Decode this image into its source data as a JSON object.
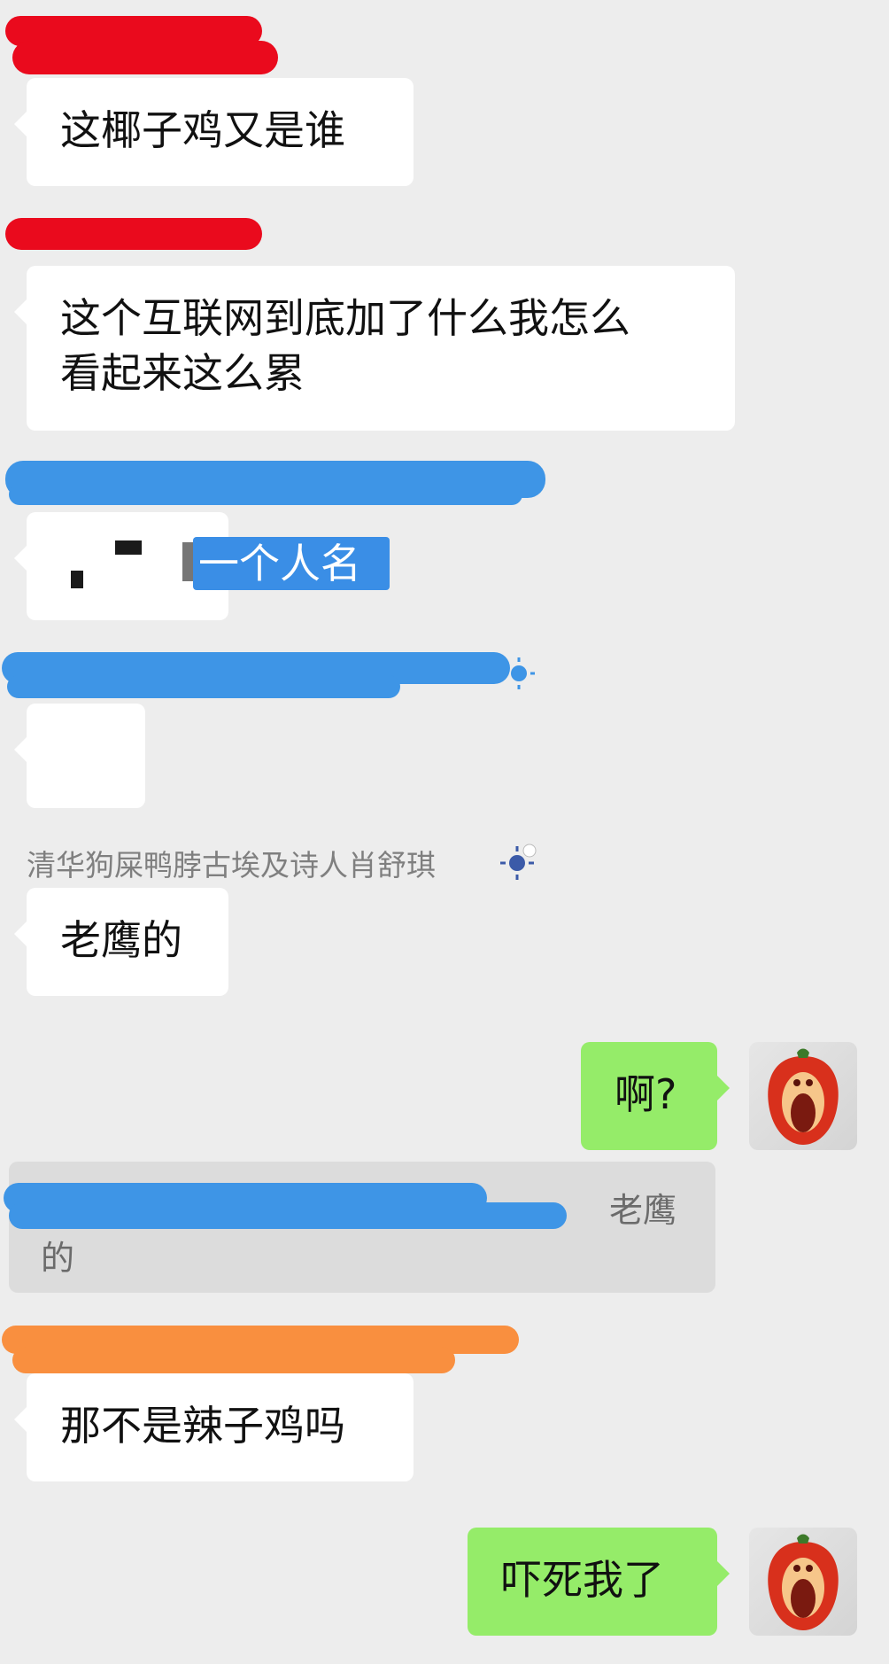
{
  "messages": {
    "m1": "这椰子鸡又是谁",
    "m2_line1": "这个互联网到底加了什么我怎么",
    "m2_line2": "看起来这么累",
    "m3_highlight": "一个人名",
    "sender5": "清华狗屎鸭脖古埃及诗人肖舒琪",
    "m5": "老鹰的",
    "m6": "啊?",
    "quote_tail": "老鹰",
    "quote_line2": "的",
    "m7": "那不是辣子鸡吗",
    "m8": "吓死我了"
  },
  "colors": {
    "background": "#ededed",
    "bubble_incoming": "#ffffff",
    "bubble_outgoing": "#95ec69",
    "redaction_red": "#ea0a1d",
    "redaction_blue": "#3e95e6",
    "redaction_orange": "#f98f3f"
  },
  "icons": [
    "sun-status-icon",
    "pepper-avatar"
  ]
}
